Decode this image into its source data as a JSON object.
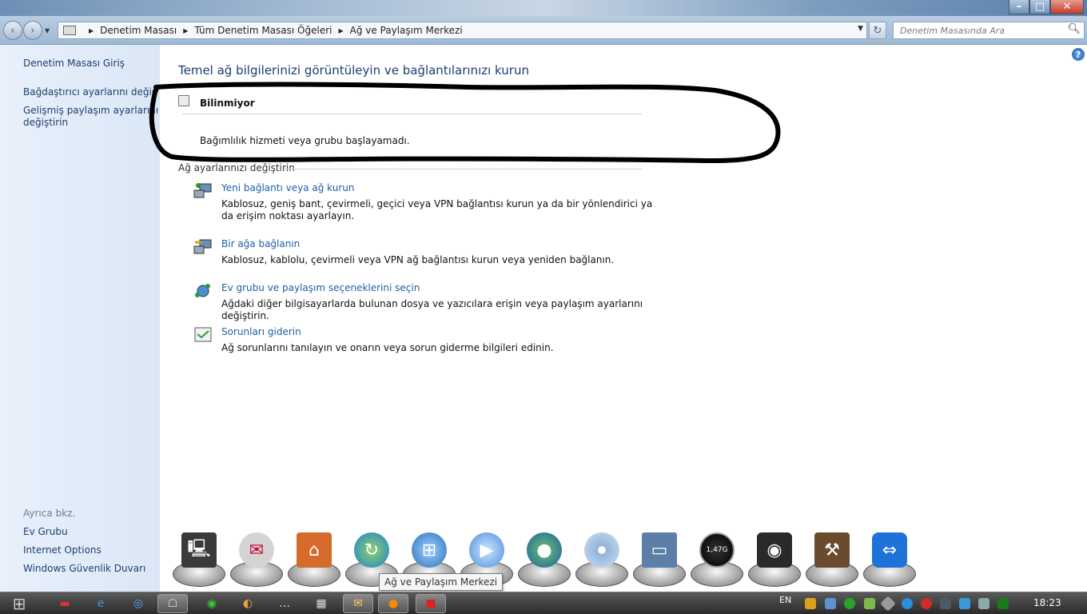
{
  "window": {
    "controls": {
      "minimize": "–",
      "maximize": "□",
      "close": "✕"
    }
  },
  "nav": {
    "back_icon": "back-arrow-icon",
    "forward_icon": "forward-arrow-icon",
    "breadcrumbs": [
      "Denetim Masası",
      "Tüm Denetim Masası Öğeleri",
      "Ağ ve Paylaşım Merkezi"
    ],
    "search_placeholder": "Denetim Masasında Ara"
  },
  "sidebar": {
    "items": [
      {
        "label": "Denetim Masası Giriş"
      },
      {
        "label": "Bağdaştırıcı ayarlarını değiştirin"
      },
      {
        "label": "Gelişmiş paylaşım ayarlarını"
      },
      {
        "label": "değiştirin"
      }
    ],
    "see_also_label": "Ayrıca bkz.",
    "see_also": [
      {
        "label": "Ev Grubu"
      },
      {
        "label": "Internet Options"
      },
      {
        "label": "Windows Güvenlik Duvarı"
      }
    ]
  },
  "main": {
    "heading": "Temel ağ bilgilerinizi görüntüleyin ve bağlantılarınızı kurun",
    "network_name": "Bilinmiyor",
    "error_message": "Bağımlılık hizmeti veya grubu başlayamadı.",
    "section_title": "Ağ ayarlarınızı değiştirin",
    "tasks": [
      {
        "link": "Yeni bağlantı veya ağ kurun",
        "desc": "Kablosuz, geniş bant, çevirmeli, geçici veya VPN bağlantısı kurun ya da bir yönlendirici ya da erişim noktası ayarlayın.",
        "icon": "new-connection-icon"
      },
      {
        "link": "Bir ağa bağlanın",
        "desc": "Kablosuz, kablolu, çevirmeli veya VPN ağ bağlantısı kurun veya yeniden bağlanın.",
        "icon": "connect-network-icon"
      },
      {
        "link": "Ev grubu ve paylaşım seçeneklerini seçin",
        "desc": "Ağdaki diğer bilgisayarlarda bulunan dosya ve yazıcılara erişin veya paylaşım ayarlarını değiştirin.",
        "icon": "homegroup-icon"
      },
      {
        "link": "Sorunları giderin",
        "desc": "Ağ sorunlarını tanılayın ve onarın veya sorun giderme bilgileri edinin.",
        "icon": "troubleshoot-icon"
      }
    ]
  },
  "dock": {
    "tooltip": "Ağ ve Paylaşım Merkezi",
    "items": [
      {
        "icon": "computer-icon",
        "color": "#3a3a3a"
      },
      {
        "icon": "mail-icon",
        "color": "#c9c9c9"
      },
      {
        "icon": "home-icon",
        "color": "#d56a2c"
      },
      {
        "icon": "network-globe-icon",
        "color": "#3a8fd1"
      },
      {
        "icon": "windows-logo-icon",
        "color": "#2f6fb8"
      },
      {
        "icon": "media-player-icon",
        "color": "#4b8fdc"
      },
      {
        "icon": "earth-icon",
        "color": "#2d8a3e"
      },
      {
        "icon": "disc-icon",
        "color": "#8fb3d9"
      },
      {
        "icon": "laptop-icon",
        "color": "#5c7fa8"
      },
      {
        "icon": "speedometer-icon",
        "color": "#1a1a1a",
        "text": "1,47G"
      },
      {
        "icon": "camera-icon",
        "color": "#2a2a2a"
      },
      {
        "icon": "tools-icon",
        "color": "#6b4b2e"
      },
      {
        "icon": "teamviewer-icon",
        "color": "#1e73d8"
      }
    ]
  },
  "taskbar": {
    "lang": "EN",
    "clock": "18:23",
    "items": [
      {
        "icon": "media-icon"
      },
      {
        "icon": "internet-explorer-icon"
      },
      {
        "icon": "browser-icon"
      },
      {
        "icon": "network-center-icon",
        "active": true
      },
      {
        "icon": "green-app-icon"
      },
      {
        "icon": "colorful-app-icon"
      },
      {
        "icon": "dots-app-icon"
      },
      {
        "icon": "calculator-icon"
      },
      {
        "icon": "mail-app-icon",
        "active": true
      },
      {
        "icon": "firefox-icon",
        "active": true
      },
      {
        "icon": "red-app-icon",
        "active": true
      }
    ]
  }
}
